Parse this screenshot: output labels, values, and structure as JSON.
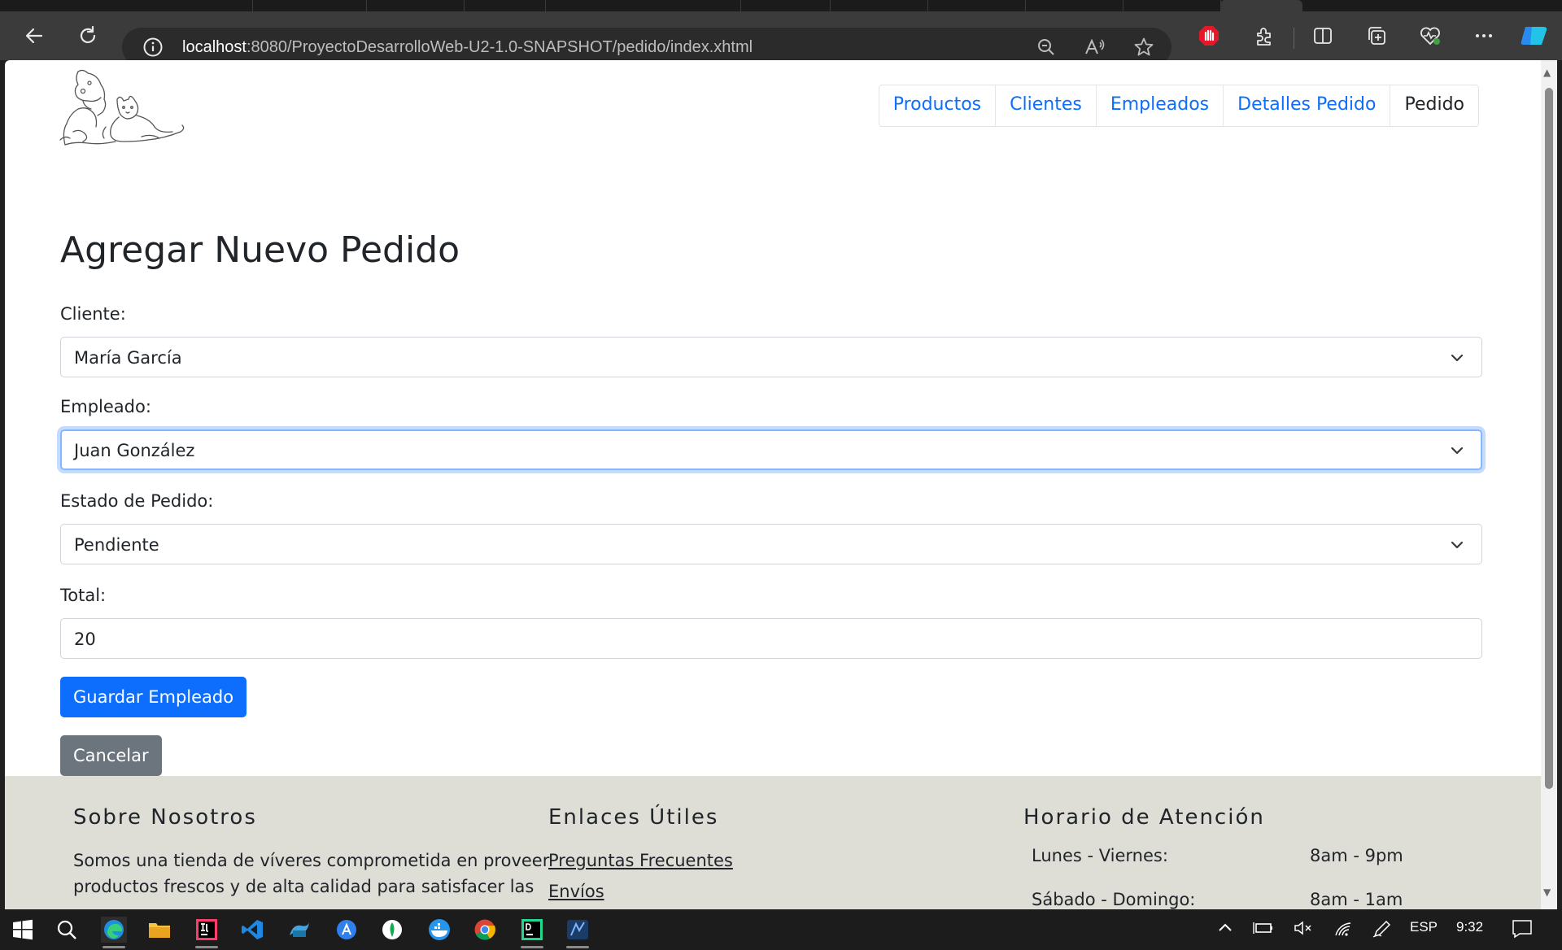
{
  "browser": {
    "url_host": "localhost",
    "url_rest": ":8080/ProyectoDesarrolloWeb-U2-1.0-SNAPSHOT/pedido/index.xhtml"
  },
  "nav": {
    "items": [
      "Productos",
      "Clientes",
      "Empleados",
      "Detalles Pedido",
      "Pedido"
    ]
  },
  "form": {
    "title": "Agregar Nuevo Pedido",
    "cliente_label": "Cliente:",
    "cliente_value": "María García",
    "empleado_label": "Empleado:",
    "empleado_value": "Juan González",
    "estado_label": "Estado de Pedido:",
    "estado_value": "Pendiente",
    "total_label": "Total:",
    "total_value": "20",
    "save_label": "Guardar Empleado",
    "cancel_label": "Cancelar"
  },
  "footer": {
    "about_title": "Sobre Nosotros",
    "about_line1": "Somos una tienda de víveres comprometida en proveer",
    "about_line2": "productos frescos y de alta calidad para satisfacer las",
    "links_title": "Enlaces Útiles",
    "link1": "Preguntas Frecuentes",
    "link2": "Envíos",
    "hours_title": "Horario de Atención",
    "hours_day1": "Lunes - Viernes:",
    "hours_time1": "8am - 9pm",
    "hours_day2": "Sábado - Domingo:",
    "hours_time2": "8am - 1am"
  },
  "taskbar": {
    "language": "ESP",
    "time": "9:32"
  },
  "colors": {
    "primary": "#0d6efd",
    "secondary": "#6c757d",
    "footer_bg": "#deded7",
    "chrome_bg": "#3b3b3b"
  }
}
